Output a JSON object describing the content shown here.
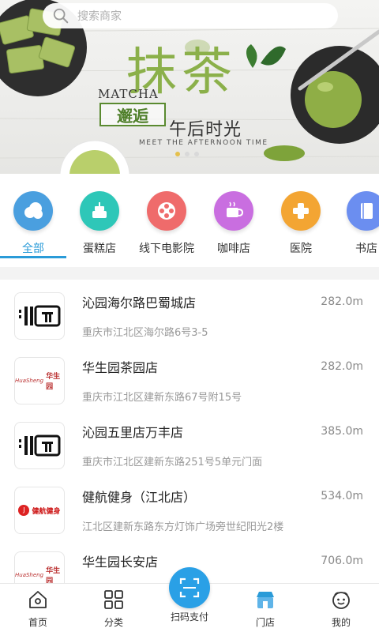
{
  "search": {
    "placeholder": "搜索商家"
  },
  "banner": {
    "title_cn": "抹茶",
    "title_en": "MATCHA",
    "meet_cn": "邂逅",
    "afternoon_cn": "午后时光",
    "meet_en": "MEET THE AFTERNOON TIME"
  },
  "categories": [
    {
      "label": "全部",
      "icon": "cloud-icon",
      "color": "#4a9fdf",
      "active": true
    },
    {
      "label": "蛋糕店",
      "icon": "cake-icon",
      "color": "#2ec7b8"
    },
    {
      "label": "线下电影院",
      "icon": "film-reel-icon",
      "color": "#ef6b6b"
    },
    {
      "label": "咖啡店",
      "icon": "coffee-cup-icon",
      "color": "#c96ee0"
    },
    {
      "label": "医院",
      "icon": "medical-cross-icon",
      "color": "#f3a533"
    },
    {
      "label": "书店",
      "icon": "book-icon",
      "color": "#6b8ef0"
    }
  ],
  "stores": [
    {
      "name": "沁园海尔路巴蜀城店",
      "distance": "282.0m",
      "address": "重庆市江北区海尔路6号3-5",
      "logo": "qinyuan"
    },
    {
      "name": "华生园茶园店",
      "distance": "282.0m",
      "address": "重庆市江北区建新东路67号附15号",
      "logo": "huashengyuan"
    },
    {
      "name": "沁园五里店万丰店",
      "distance": "385.0m",
      "address": "重庆市江北区建新东路251号5单元门面",
      "logo": "qinyuan"
    },
    {
      "name": "健航健身（江北店）",
      "distance": "534.0m",
      "address": "江北区建新东路东方灯饰广场旁世纪阳光2楼",
      "logo": "jianhang"
    },
    {
      "name": "华生园长安店",
      "distance": "706.0m",
      "address": "",
      "logo": "huashengyuan"
    }
  ],
  "nav": {
    "home": "首页",
    "category": "分类",
    "scan": "扫码支付",
    "store": "门店",
    "mine": "我的"
  },
  "logo_text": {
    "huashengyuan": "华生园",
    "jianhang": "健航健身"
  },
  "colors": {
    "accent": "#2a9bd8",
    "matcha": "#8bb04a"
  }
}
